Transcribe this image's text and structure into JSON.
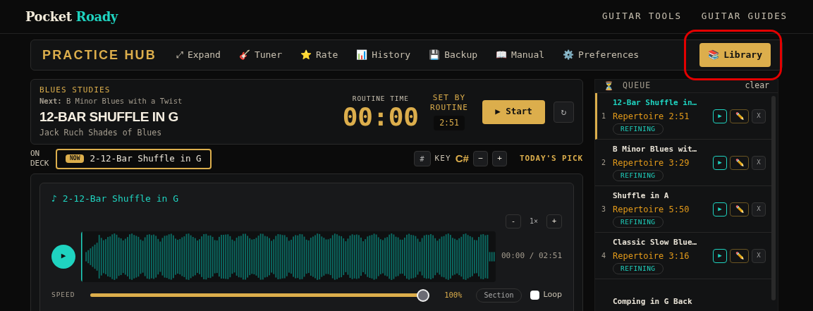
{
  "brand": {
    "first": "Pocket",
    "second": "Roady"
  },
  "top_nav": [
    "GUITAR TOOLS",
    "GUITAR GUIDES"
  ],
  "hub": {
    "title": "PRACTICE HUB",
    "items": [
      {
        "icon": "⤢",
        "label": "Expand",
        "selected": false
      },
      {
        "icon": "🎸",
        "label": "Tuner",
        "selected": false
      },
      {
        "icon": "⭐",
        "label": "Rate",
        "selected": false
      },
      {
        "icon": "📊",
        "label": "History",
        "selected": false
      },
      {
        "icon": "💾",
        "label": "Backup",
        "selected": false
      },
      {
        "icon": "📖",
        "label": "Manual",
        "selected": false
      },
      {
        "icon": "⚙️",
        "label": "Preferences",
        "selected": false
      },
      {
        "icon": "📚",
        "label": "Library",
        "selected": true,
        "highlighted": true
      }
    ]
  },
  "current": {
    "category": "BLUES STUDIES",
    "next_label": "Next:",
    "next_title": "B Minor Blues with a Twist",
    "title": "12-BAR SHUFFLE IN G",
    "source": "Jack Ruch Shades of Blues",
    "routine_label": "ROUTINE TIME",
    "timer": "00:00",
    "set_by_label": "SET BY ROUTINE",
    "set_by_value": "2:51",
    "start": "▶ Start",
    "reset": "↻"
  },
  "deck": {
    "label": "ON DECK",
    "badge": "NOW",
    "title": "2-12-Bar Shuffle in G",
    "sharp": "#",
    "key_label": "KEY",
    "key": "C#",
    "minus": "−",
    "plus": "+",
    "pick": "TODAY'S PICK"
  },
  "player": {
    "title": "♪ 2-12-Bar Shuffle in G",
    "zoom_minus": "-",
    "zoom": "1×",
    "zoom_plus": "+",
    "play": "▶",
    "time": "00:00 / 02:51",
    "speed_label": "SPEED",
    "speed": {
      "level": 1
    },
    "speed_reading": "100%",
    "section": "Section",
    "loop": {
      "label": "Loop",
      "checked": false
    }
  },
  "queue": {
    "icon": "⏳",
    "title": "QUEUE",
    "clear": "clear",
    "items": [
      {
        "number": "1",
        "title": "12-Bar Shuffle in…",
        "category": "Repertoire",
        "time": "2:51",
        "status": "REFINING",
        "selected": true,
        "play": "▶",
        "edit": "✏️",
        "remove": "X"
      },
      {
        "number": "2",
        "title": "B Minor Blues wit…",
        "category": "Repertoire",
        "time": "3:29",
        "status": "REFINING",
        "selected": false,
        "play": "▶",
        "edit": "✏️",
        "remove": "X"
      },
      {
        "number": "3",
        "title": "Shuffle in A",
        "category": "Repertoire",
        "time": "5:50",
        "status": "REFINING",
        "selected": false,
        "play": "▶",
        "edit": "✏️",
        "remove": "X"
      },
      {
        "number": "4",
        "title": "Classic Slow Blue…",
        "category": "Repertoire",
        "time": "3:16",
        "status": "REFINING",
        "selected": false,
        "play": "▶",
        "edit": "✏️",
        "remove": "X"
      },
      {
        "title": "Comping in G Back",
        "selected": false
      }
    ]
  }
}
